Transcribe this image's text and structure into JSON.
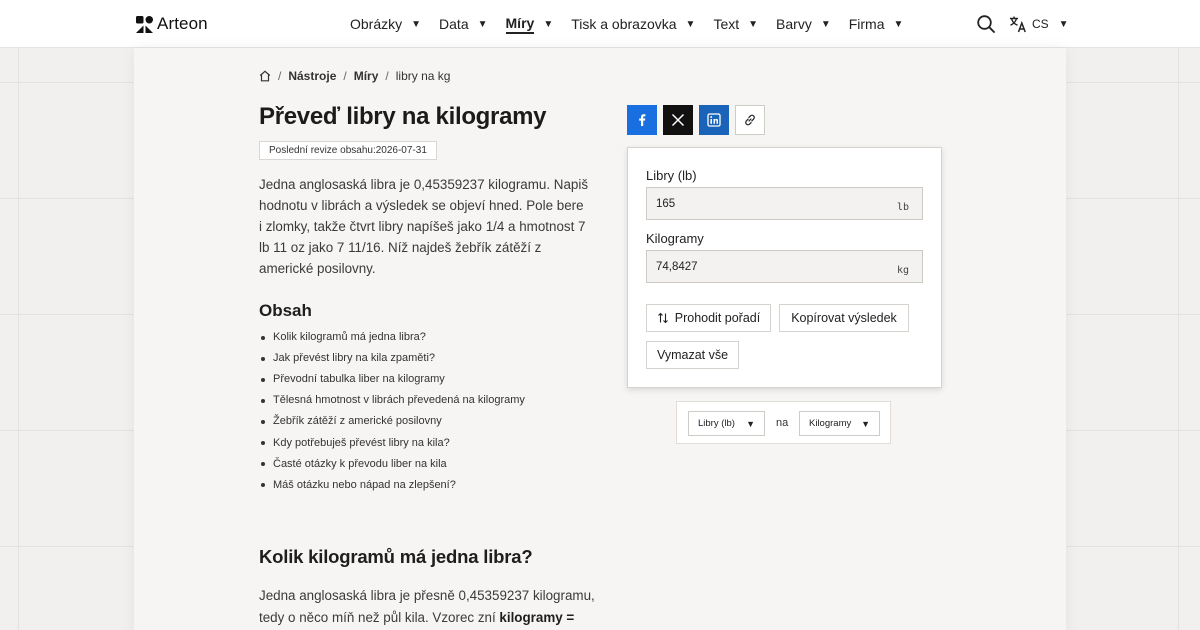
{
  "header": {
    "logo_text": "Arteon",
    "nav": [
      {
        "label": "Obrázky"
      },
      {
        "label": "Data"
      },
      {
        "label": "Míry"
      },
      {
        "label": "Tisk a obrazovka"
      },
      {
        "label": "Text"
      },
      {
        "label": "Barvy"
      },
      {
        "label": "Firma"
      }
    ],
    "lang": "CS"
  },
  "breadcrumb": {
    "items": [
      "Nástroje",
      "Míry",
      "libry na kg"
    ]
  },
  "page": {
    "title": "Převeď libry na kilogramy",
    "revision": "Poslední revize obsahu:2026-07-31",
    "intro": "Jedna anglosaská libra je 0,45359237 kilogramu. Napiš hodnotu v librách a výsledek se objeví hned. Pole bere i zlomky, takže čtvrt libry napíšeš jako 1/4 a hmotnost 7 lb 11 oz jako 7 11/16. Níž najdeš žebřík zátěží z americké posilovny."
  },
  "toc": {
    "title": "Obsah",
    "items": [
      "Kolik kilogramů má jedna libra?",
      "Jak převést libry na kila zpaměti?",
      "Převodní tabulka liber na kilogramy",
      "Tělesná hmotnost v librách převedená na kilogramy",
      "Žebřík zátěží z americké posilovny",
      "Kdy potřebuješ převést libry na kila?",
      "Časté otázky k převodu liber na kila",
      "Máš otázku nebo nápad na zlepšení?"
    ]
  },
  "section": {
    "heading": "Kolik kilogramů má jedna libra?",
    "text_start": "Jedna anglosaská libra je přesně 0,45359237 kilogramu, tedy o něco míň než půl kila. Vzorec zní ",
    "text_bold": "kilogramy = libry ×"
  },
  "converter": {
    "label_from": "Libry (lb)",
    "value_from": "165",
    "unit_from": "lb",
    "label_to": "Kilogramy",
    "value_to": "74,8427",
    "unit_to": "kg",
    "swap_label": "Prohodit pořadí",
    "copy_label": "Kopírovat výsledek",
    "clear_label": "Vymazat vše"
  },
  "unit_selector": {
    "from": "Libry (lb)",
    "connector": "na",
    "to": "Kilogramy"
  },
  "colors": {
    "facebook": "#1a6fe0",
    "x": "#111111",
    "linkedin": "#1964b8"
  }
}
